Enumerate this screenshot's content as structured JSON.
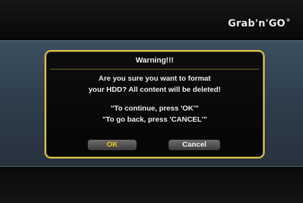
{
  "brand": {
    "name": "Grab'n'GO",
    "registered_mark": "®"
  },
  "dialog": {
    "title": "Warning!!!",
    "message_lines": [
      "Are you sure you want to format",
      "your HDD? All content will be deleted!",
      "\"To continue, press 'OK'\"",
      "\"To go back, press 'CANCEL'\""
    ],
    "buttons": {
      "ok_label": "OK",
      "cancel_label": "Cancel"
    }
  },
  "colors": {
    "dialog_border": "#e7c74c",
    "ok_text": "#f0c21a",
    "band": "#3d5060",
    "background": "#0b0b0b"
  }
}
